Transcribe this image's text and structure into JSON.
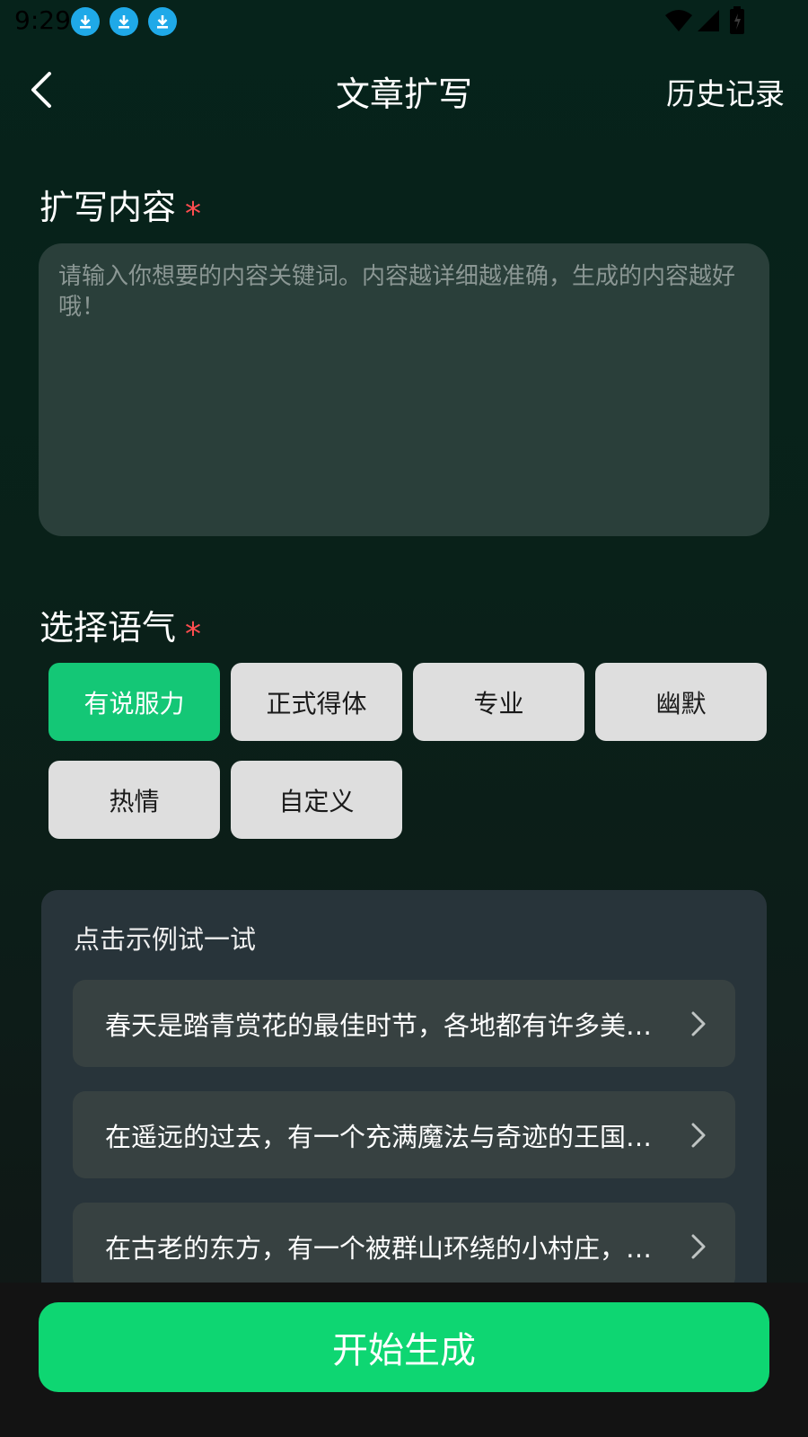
{
  "status_bar": {
    "time": "9:29",
    "icons": [
      "download-icon",
      "download-icon",
      "download-icon",
      "wifi-icon",
      "cell-signal-icon",
      "battery-icon"
    ]
  },
  "header": {
    "title": "文章扩写",
    "history_label": "历史记录"
  },
  "content_section": {
    "label": "扩写内容",
    "required_mark": "*",
    "input_placeholder": "请输入你想要的内容关键词。内容越详细越准确，生成的内容越好哦！",
    "input_value": ""
  },
  "tone_section": {
    "label": "选择语气",
    "required_mark": "*",
    "options": [
      "有说服力",
      "正式得体",
      "专业",
      "幽默",
      "热情",
      "自定义"
    ],
    "selected": "有说服力"
  },
  "examples": {
    "title": "点击示例试一试",
    "items": [
      "春天是踏青赏花的最佳时节，各地都有许多美丽的赏花胜地",
      "在遥远的过去，有一个充满魔法与奇迹的王国，那里住着",
      "在古老的东方，有一个被群山环绕的小村庄，村里的人们"
    ]
  },
  "start_button_label": "开始生成",
  "colors": {
    "accent": "#0ed672",
    "chip_selected": "#14c776",
    "required_star": "#ff4d4f",
    "download_badge": "#1fa9e8"
  }
}
